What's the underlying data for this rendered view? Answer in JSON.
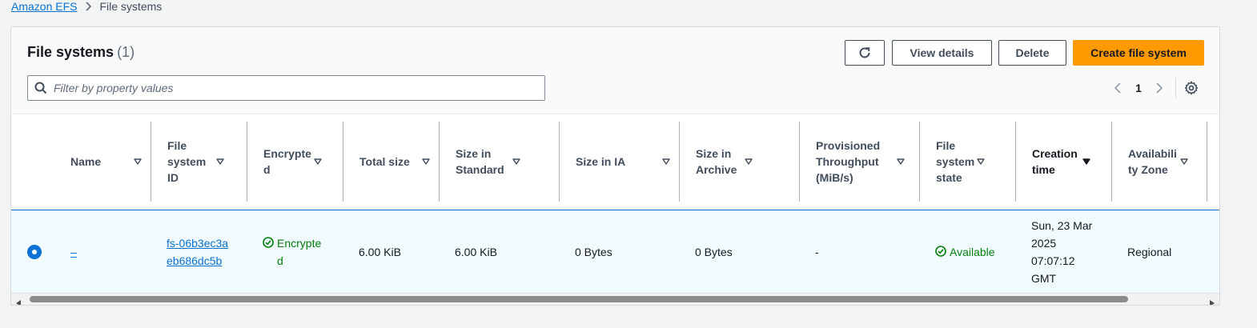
{
  "breadcrumb": {
    "root": "Amazon EFS",
    "current": "File systems"
  },
  "header": {
    "title": "File systems",
    "count": "(1)",
    "buttons": {
      "view_details": "View details",
      "delete": "Delete",
      "create": "Create file system"
    }
  },
  "filter": {
    "placeholder": "Filter by property values",
    "value": ""
  },
  "pagination": {
    "page": "1"
  },
  "table": {
    "columns": [
      "Name",
      "File system ID",
      "Encrypted",
      "Total size",
      "Size in Standard",
      "Size in IA",
      "Size in Archive",
      "Provisioned Throughput (MiB/s)",
      "File system state",
      "Creation time",
      "Availability Zone"
    ],
    "sorted_column": "Creation time",
    "sort_direction": "descending",
    "rows": [
      {
        "selected": true,
        "name": "–",
        "file_system_id": "fs-06b3ec3aeb686dc5b",
        "encrypted": "Encrypted",
        "total_size": "6.00 KiB",
        "size_standard": "6.00 KiB",
        "size_ia": "0 Bytes",
        "size_archive": "0 Bytes",
        "provisioned_throughput": "-",
        "state": "Available",
        "creation_time": "Sun, 23 Mar 2025 07:07:12 GMT",
        "availability_zone": "Regional"
      }
    ]
  },
  "icons": {
    "breadcrumb_separator": "chevron-right-icon",
    "refresh": "refresh-icon",
    "search": "search-icon",
    "prev_page": "chevron-left-icon",
    "next_page": "chevron-right-icon",
    "settings": "gear-icon",
    "sort": "caret-down-icon",
    "status_ok": "check-circle-icon"
  },
  "colors": {
    "accent": "#0972d3",
    "primary_button": "#ff9900",
    "success": "#037f0c",
    "selected_row_bg": "#f1faff"
  }
}
